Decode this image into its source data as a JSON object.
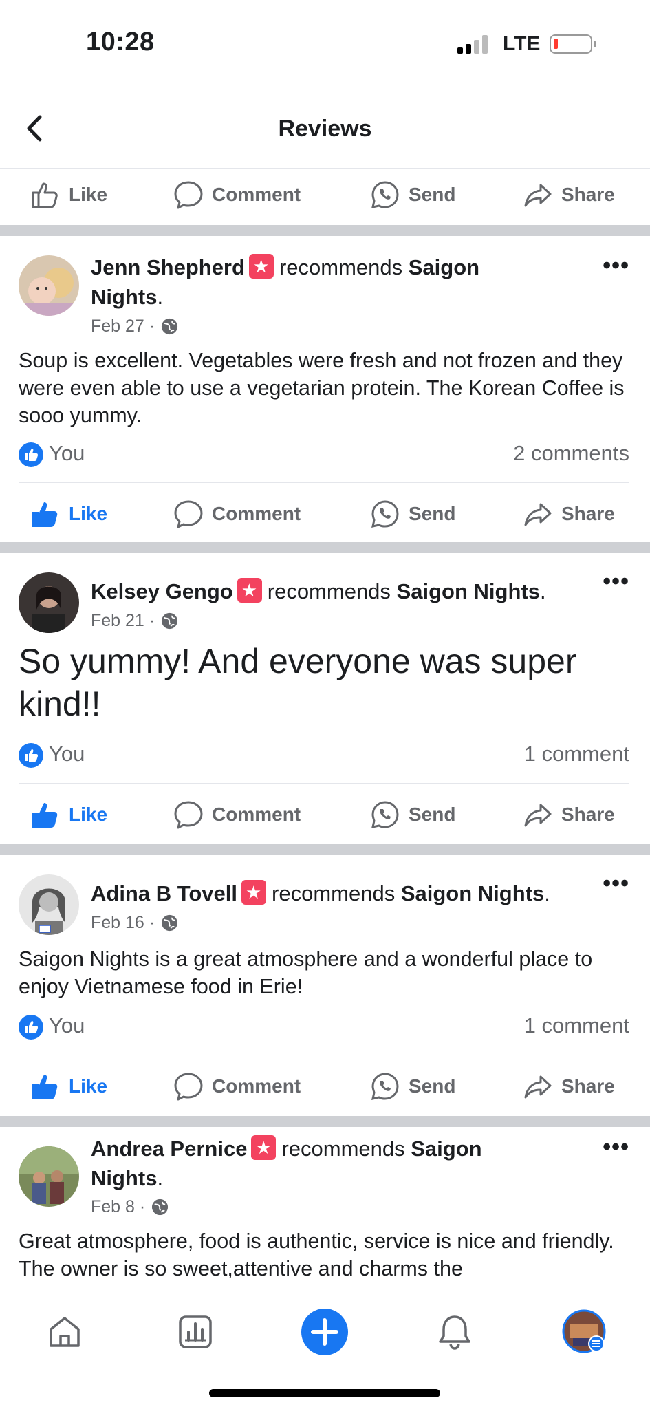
{
  "status": {
    "time": "10:28",
    "network": "LTE"
  },
  "header": {
    "title": "Reviews"
  },
  "actions": {
    "like": "Like",
    "comment": "Comment",
    "send": "Send",
    "share": "Share"
  },
  "posts": [
    {
      "name": "Jenn Shepherd",
      "recommends": "recommends",
      "page_part1": "Saigon",
      "page_part2": "Nights",
      "date": "Feb 27",
      "text": "Soup is excellent. Vegetables were fresh and not frozen and they were even able to use a vegetarian protein. The Korean Coffee is sooo yummy.",
      "reactor": "You",
      "comments": "2 comments"
    },
    {
      "name": "Kelsey Gengo",
      "recommends": "recommends",
      "page": "Saigon Nights",
      "date": "Feb 21",
      "text": "So yummy! And everyone was super kind!!",
      "reactor": "You",
      "comments": "1 comment"
    },
    {
      "name": "Adina B Tovell",
      "recommends": "recommends",
      "page": "Saigon Nights",
      "date": "Feb 16",
      "text": "Saigon Nights is a great atmosphere and a wonderful place to enjoy Vietnamese food in Erie!",
      "reactor": "You",
      "comments": "1 comment"
    },
    {
      "name": "Andrea Pernice",
      "recommends": "recommends",
      "page_part1": "Saigon",
      "page_part2": "Nights",
      "date": "Feb 8",
      "text": "Great atmosphere, food is authentic, service is nice and friendly. The owner is so sweet,attentive and charms the"
    }
  ],
  "icons": {
    "back": "chevron-left-icon",
    "like": "thumbs-up-icon",
    "comment": "speech-bubble-icon",
    "send": "whatsapp-icon",
    "share": "share-arrow-icon",
    "globe": "globe-icon",
    "more": "more-dots-icon",
    "tabs": [
      "home-icon",
      "insights-icon",
      "create-plus-icon",
      "bell-icon",
      "profile-avatar-icon"
    ]
  },
  "colors": {
    "accent": "#1877f2",
    "recommend_badge": "#f3425f",
    "divider": "#ced0d4",
    "muted_text": "#65676b"
  }
}
